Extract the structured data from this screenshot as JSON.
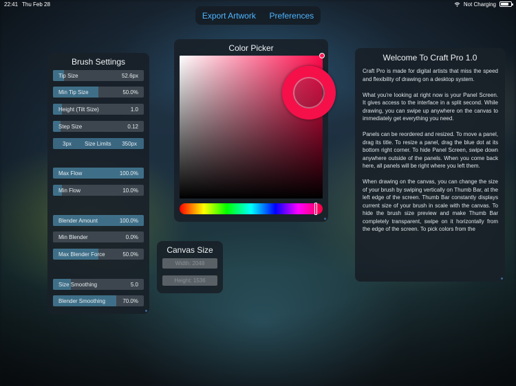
{
  "status_bar": {
    "time": "22:41",
    "date": "Thu Feb 28",
    "battery_text": "Not Charging",
    "wifi_icon": "wifi-icon",
    "battery_icon": "battery-icon"
  },
  "top_menu": {
    "export_label": "Export Artwork",
    "preferences_label": "Preferences",
    "accent": "#4fb6ff"
  },
  "brush_settings": {
    "title": "Brush Settings",
    "sliders": [
      {
        "label": "Tip Size",
        "value": "52.6px",
        "fill": 0.12
      },
      {
        "label": "Min Tip Size",
        "value": "50.0%",
        "fill": 0.5
      },
      {
        "label": "Height (Tilt Size)",
        "value": "1.0",
        "fill": 0.1
      },
      {
        "label": "Step Size",
        "value": "0.12",
        "fill": 0.08
      },
      {
        "label": "Max Flow",
        "value": "100.0%",
        "fill": 1.0
      },
      {
        "label": "Min Flow",
        "value": "10.0%",
        "fill": 0.1
      },
      {
        "label": "Blender Amount",
        "value": "100.0%",
        "fill": 1.0
      },
      {
        "label": "Min Blender",
        "value": "0.0%",
        "fill": 0.0
      },
      {
        "label": "Max Blender Force",
        "value": "50.0%",
        "fill": 0.5
      },
      {
        "label": "Size Smoothing",
        "value": "5.0",
        "fill": 0.2
      },
      {
        "label": "Blender Smoothing",
        "value": "70.0%",
        "fill": 0.7
      }
    ],
    "size_limits": {
      "min": "3px",
      "label": "Size Limits",
      "max": "350px",
      "fill_start": 0.0,
      "fill_end": 1.0
    }
  },
  "color_picker": {
    "title": "Color Picker",
    "selected_color": "#ff0a4a"
  },
  "canvas_size": {
    "title": "Canvas Size",
    "width_label": "Width: 2048",
    "height_label": "Height: 1536"
  },
  "welcome": {
    "title": "Welcome To Craft Pro 1.0",
    "paragraphs": [
      "Craft Pro is made for digital artists that miss the speed and flexibility of drawing on a desktop system.",
      "What you're looking at right now is your Panel Screen. It gives access to the interface in a split second. While drawing, you can swipe up anywhere on the canvas to immediately get everything you need.",
      "Panels can be reordered and resized. To move a panel, drag its title. To resize a panel, drag the blue dot at its bottom right corner. To hide Panel Screen, swipe down anywhere outside of the panels. When you come back here, all panels will be right where you left them.",
      "When drawing on the canvas, you can change the size of your brush by swiping vertically on Thumb Bar, at the left edge of the screen. Thumb Bar constantly displays current size of your brush in scale with the canvas. To hide the brush size preview and make Thumb Bar completely transparent, swipe on it horizontally from the edge of the screen. To pick colors from the"
    ]
  }
}
